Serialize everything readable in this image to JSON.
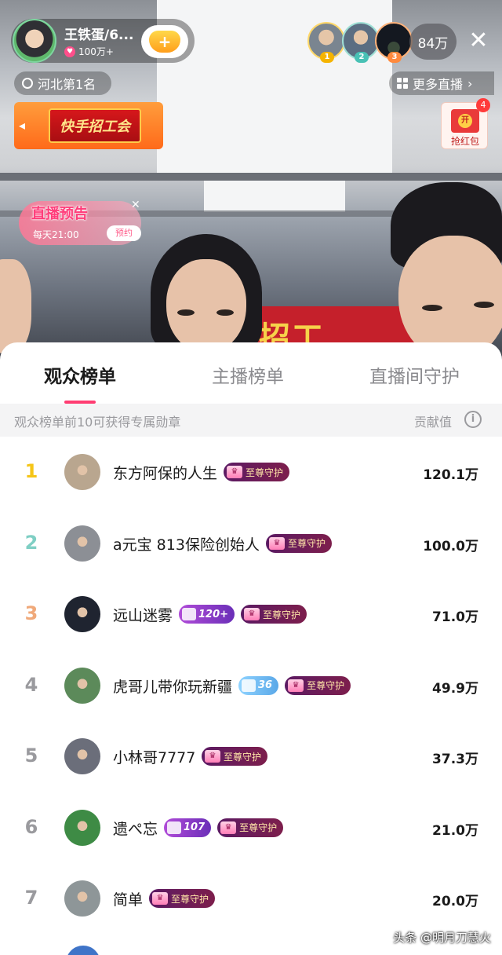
{
  "host": {
    "name": "王铁蛋/6...",
    "likes": "100万+",
    "region_rank": "河北第1名"
  },
  "top_viewers": [
    {
      "rank": "1",
      "color": "#f5b400"
    },
    {
      "rank": "2",
      "color": "#48c1b5"
    },
    {
      "rank": "3",
      "color": "#ff8a3d"
    }
  ],
  "viewer_count": "84万",
  "more_live_label": "更多直播",
  "promo_label": "快手招工会",
  "red_packet": {
    "label": "抢红包",
    "badge": "开",
    "count": "4"
  },
  "live_preview": {
    "title": "直播预告",
    "time": "每天21:00",
    "button": "预约"
  },
  "tabs": [
    {
      "label": "观众榜单",
      "active": true
    },
    {
      "label": "主播榜单",
      "active": false
    },
    {
      "label": "直播间守护",
      "active": false
    }
  ],
  "subheader": {
    "left": "观众榜单前10可获得专属勋章",
    "right": "贡献值"
  },
  "ranking": [
    {
      "rank": "1",
      "name": "东方阿保的人生",
      "level": "",
      "guard": "至尊守护",
      "value": "120.1万",
      "rank_color": "#f5c518",
      "avatar_color": "#b9a68f"
    },
    {
      "rank": "2",
      "name": "a元宝 813保险创始人",
      "level": "",
      "guard": "至尊守护",
      "value": "100.0万",
      "rank_color": "#7fcfc4",
      "avatar_color": "#8c8f95"
    },
    {
      "rank": "3",
      "name": "远山迷雾",
      "level": "120+",
      "level_style": "purple",
      "guard": "至尊守护",
      "value": "71.0万",
      "rank_color": "#f0a97a",
      "avatar_color": "#1f2430"
    },
    {
      "rank": "4",
      "name": "虎哥儿带你玩新疆",
      "level": "36",
      "level_style": "blue",
      "guard": "至尊守护",
      "value": "49.9万",
      "rank_color": "#9a9a9e",
      "avatar_color": "#5c8a5a"
    },
    {
      "rank": "5",
      "name": "小林哥7777",
      "level": "",
      "guard": "至尊守护",
      "value": "37.3万",
      "rank_color": "#9a9a9e",
      "avatar_color": "#6b6e7a"
    },
    {
      "rank": "6",
      "name": "遗ぺ忘",
      "level": "107",
      "level_style": "purple",
      "guard": "至尊守护",
      "value": "21.0万",
      "rank_color": "#9a9a9e",
      "avatar_color": "#3e8b45"
    },
    {
      "rank": "7",
      "name": "简单",
      "level": "",
      "guard": "至尊守护",
      "value": "20.0万",
      "rank_color": "#9a9a9e",
      "avatar_color": "#8e9698"
    }
  ],
  "watermark": "头条 @明月刀慧火"
}
